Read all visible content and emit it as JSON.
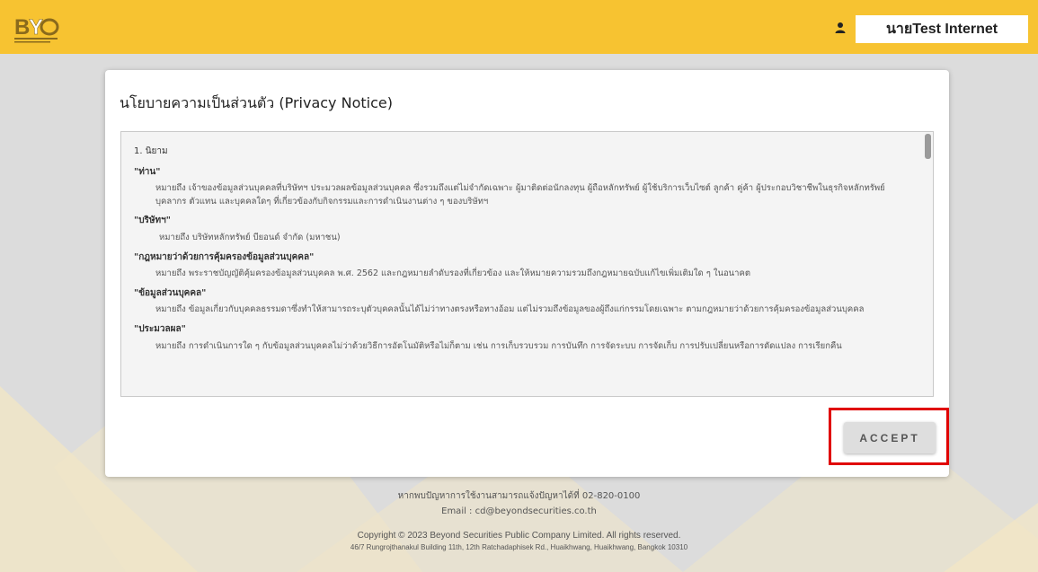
{
  "colors": {
    "header_bg": "#f7c331",
    "page_bg": "#dcdcdc",
    "highlight_border": "#e00000"
  },
  "header": {
    "logo_icon": "beyond-securities-logo",
    "user_icon": "user-icon",
    "user_name": "นายTest Internet"
  },
  "privacy": {
    "title": "นโยบายความเป็นส่วนตัว (Privacy Notice)",
    "section": "1. นิยาม",
    "terms": [
      {
        "term": "\"ท่าน\"",
        "definition": "หมายถึง เจ้าของข้อมูลส่วนบุคคลที่บริษัทฯ ประมวลผลข้อมูลส่วนบุคคล ซึ่งรวมถึงแต่ไม่จำกัดเฉพาะ ผู้มาติดต่อนักลงทุน ผู้ถือหลักทรัพย์ ผู้ใช้บริการเว็บไซต์ ลูกค้า คู่ค้า ผู้ประกอบวิชาชีพในธุรกิจหลักทรัพย์ บุคลากร ตัวแทน และบุคคลใดๆ ที่เกี่ยวข้องกับกิจกรรมและการดำเนินงานต่าง ๆ ของบริษัทฯ"
      },
      {
        "term": "\"บริษัทฯ\"",
        "definition": "หมายถึง บริษัทหลักทรัพย์ บียอนด์ จำกัด (มหาชน)"
      },
      {
        "term": "\"กฎหมายว่าด้วยการคุ้มครองข้อมูลส่วนบุคคล\"",
        "definition": "หมายถึง พระราชบัญญัติคุ้มครองข้อมูลส่วนบุคคล พ.ศ. 2562 และกฎหมายลำดับรองที่เกี่ยวข้อง และให้หมายความรวมถึงกฎหมายฉบับแก้ไขเพิ่มเติมใด ๆ ในอนาคต"
      },
      {
        "term": "\"ข้อมูลส่วนบุคคล\"",
        "definition": "หมายถึง ข้อมูลเกี่ยวกับบุคคลธรรมดาซึ่งทำให้สามารถระบุตัวบุคคลนั้นได้ไม่ว่าทางตรงหรือทางอ้อม แต่ไม่รวมถึงข้อมูลของผู้ถึงแก่กรรมโดยเฉพาะ ตามกฎหมายว่าด้วยการคุ้มครองข้อมูลส่วนบุคคล"
      },
      {
        "term": "\"ประมวลผล\"",
        "definition": "หมายถึง การดำเนินการใด ๆ กับข้อมูลส่วนบุคคลไม่ว่าด้วยวิธีการอัตโนมัติหรือไม่ก็ตาม เช่น การเก็บรวบรวม การบันทึก การจัดระบบ การจัดเก็บ การปรับเปลี่ยนหรือการดัดแปลง การเรียกคืน"
      }
    ],
    "accept_label": "ACCEPT"
  },
  "footer": {
    "contact_line": "หากพบปัญหาการใช้งานสามารถแจ้งปัญหาได้ที่ 02-820-0100",
    "email_line": "Email : cd@beyondsecurities.co.th",
    "copyright": "Copyright © 2023 Beyond Securities Public Company Limited. All rights reserved.",
    "address": "46/7 Rungrojthanakul Building 11th, 12th Ratchadaphisek Rd., Huaikhwang, Huaikhwang, Bangkok 10310"
  }
}
